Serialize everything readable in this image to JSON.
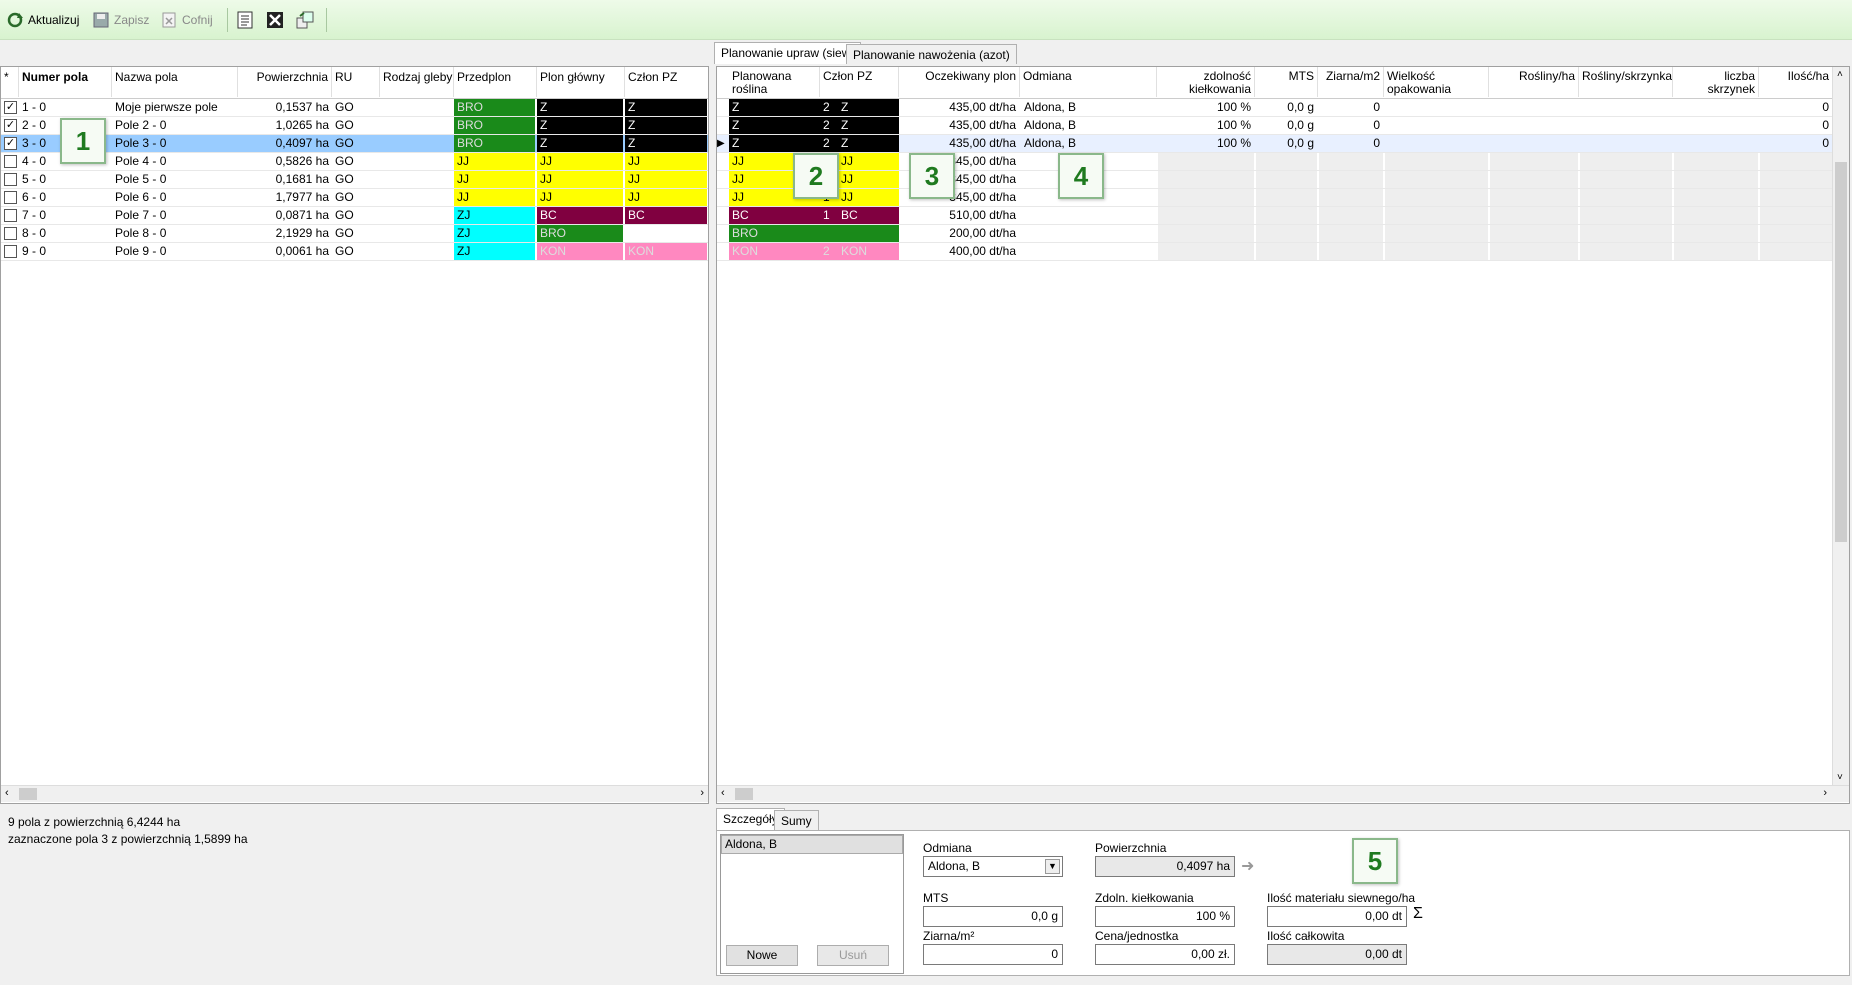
{
  "colors": {
    "BRO": "#1a8a1a",
    "Z": "#000000",
    "JJ": "#ffff00",
    "ZJ": "#00ffff",
    "BC": "#800040",
    "KON": "#ff88c0"
  },
  "toolbar": {
    "refresh": "Aktualizuj",
    "save": "Zapisz",
    "undo": "Cofnij"
  },
  "fields_grid": {
    "headers": [
      "*",
      "Numer pola",
      "Nazwa pola",
      "Powierzchnia",
      "RU",
      "Rodzaj gleby",
      "Przedplon",
      "Plon główny",
      "Człon PZ"
    ],
    "rows": [
      {
        "checked": true,
        "num": "1 - 0",
        "name": "Moje pierwsze pole",
        "area": "0,1537 ha",
        "ru": "GO",
        "soil": "",
        "pre": "BRO",
        "main": "Z",
        "pz": "Z"
      },
      {
        "checked": true,
        "num": "2 - 0",
        "name": "Pole 2 - 0",
        "area": "1,0265 ha",
        "ru": "GO",
        "soil": "",
        "pre": "BRO",
        "main": "Z",
        "pz": "Z"
      },
      {
        "checked": true,
        "num": "3 - 0",
        "name": "Pole 3 - 0",
        "area": "0,4097 ha",
        "ru": "GO",
        "soil": "",
        "pre": "BRO",
        "main": "Z",
        "pz": "Z"
      },
      {
        "checked": false,
        "num": "4 - 0",
        "name": "Pole 4 - 0",
        "area": "0,5826 ha",
        "ru": "GO",
        "soil": "",
        "pre": "JJ",
        "main": "JJ",
        "pz": "JJ"
      },
      {
        "checked": false,
        "num": "5 - 0",
        "name": "Pole 5 - 0",
        "area": "0,1681 ha",
        "ru": "GO",
        "soil": "",
        "pre": "JJ",
        "main": "JJ",
        "pz": "JJ"
      },
      {
        "checked": false,
        "num": "6 - 0",
        "name": "Pole 6 - 0",
        "area": "1,7977 ha",
        "ru": "GO",
        "soil": "",
        "pre": "JJ",
        "main": "JJ",
        "pz": "JJ"
      },
      {
        "checked": false,
        "num": "7 - 0",
        "name": "Pole 7 - 0",
        "area": "0,0871 ha",
        "ru": "GO",
        "soil": "",
        "pre": "ZJ",
        "main": "BC",
        "pz": "BC"
      },
      {
        "checked": false,
        "num": "8 - 0",
        "name": "Pole 8 - 0",
        "area": "2,1929 ha",
        "ru": "GO",
        "soil": "",
        "pre": "ZJ",
        "main": "BRO",
        "pz": ""
      },
      {
        "checked": false,
        "num": "9 - 0",
        "name": "Pole 9 - 0",
        "area": "0,0061 ha",
        "ru": "GO",
        "soil": "",
        "pre": "ZJ",
        "main": "KON",
        "pz": "KON"
      }
    ],
    "summary_line1": "9 pola z powierzchnią 6,4244 ha",
    "summary_line2": "zaznaczone pola 3 z powierzchnią 1,5899 ha"
  },
  "tabs": [
    "Planowanie upraw (siew)",
    "Planowanie nawożenia (azot)"
  ],
  "plan_grid": {
    "headers": [
      "Planowana roślina uprawna",
      "Człon PZ",
      "Oczekiwany plon",
      "Odmiana",
      "zdolność kiełkowania",
      "MTS",
      "Ziarna/m2",
      "Wielkość opakowania",
      "Rośliny/ha",
      "Rośliny/skrzynka",
      "liczba skrzynek",
      "Ilość/ha"
    ],
    "rows": [
      {
        "plant": "Z",
        "pznum": "2",
        "pz": "Z",
        "yield": "435,00 dt/ha",
        "variety": "Aldona, B",
        "germ": "100 %",
        "mts": "0,0 g",
        "grains": "0",
        "last": "0"
      },
      {
        "plant": "Z",
        "pznum": "2",
        "pz": "Z",
        "yield": "435,00 dt/ha",
        "variety": "Aldona, B",
        "germ": "100 %",
        "mts": "0,0 g",
        "grains": "0",
        "last": "0"
      },
      {
        "plant": "Z",
        "pznum": "2",
        "pz": "Z",
        "yield": "435,00 dt/ha",
        "variety": "Aldona, B",
        "germ": "100 %",
        "mts": "0,0 g",
        "grains": "0",
        "last": "0"
      },
      {
        "plant": "JJ",
        "pznum": "",
        "pz": "JJ",
        "yield": "345,00 dt/ha",
        "variety": "",
        "germ": "",
        "mts": "",
        "grains": "",
        "last": ""
      },
      {
        "plant": "JJ",
        "pznum": "",
        "pz": "JJ",
        "yield": "345,00 dt/ha",
        "variety": "",
        "germ": "",
        "mts": "",
        "grains": "",
        "last": ""
      },
      {
        "plant": "JJ",
        "pznum": "1",
        "pz": "JJ",
        "yield": "345,00 dt/ha",
        "variety": "",
        "germ": "",
        "mts": "",
        "grains": "",
        "last": ""
      },
      {
        "plant": "BC",
        "pznum": "1",
        "pz": "BC",
        "yield": "510,00 dt/ha",
        "variety": "",
        "germ": "",
        "mts": "",
        "grains": "",
        "last": ""
      },
      {
        "plant": "BRO",
        "pznum": "",
        "pz": "",
        "yield": "200,00 dt/ha",
        "variety": "",
        "germ": "",
        "mts": "",
        "grains": "",
        "last": ""
      },
      {
        "plant": "KON",
        "pznum": "2",
        "pz": "KON",
        "yield": "400,00 dt/ha",
        "variety": "",
        "germ": "",
        "mts": "",
        "grains": "",
        "last": ""
      }
    ]
  },
  "detail_tabs": [
    "Szczegóły",
    "Sumy"
  ],
  "details": {
    "list_item": "Aldona, B",
    "new_btn": "Nowe",
    "del_btn": "Usuń",
    "variety_label": "Odmiana",
    "variety_value": "Aldona, B",
    "area_label": "Powierzchnia",
    "area_value": "0,4097 ha",
    "mts_label": "MTS",
    "mts_value": "0,0 g",
    "germ_label": "Zdoln. kiełkowania",
    "germ_value": "100 %",
    "seed_label": "Ilość materiału siewnego/ha",
    "seed_value": "0,00 dt",
    "grains_label": "Ziarna/m²",
    "grains_value": "0",
    "price_label": "Cena/jednostka",
    "price_value": "0,00 zł.",
    "total_label": "Ilość całkowita",
    "total_value": "0,00 dt",
    "sigma": "Σ"
  },
  "callouts": [
    "1",
    "2",
    "3",
    "4",
    "5"
  ]
}
